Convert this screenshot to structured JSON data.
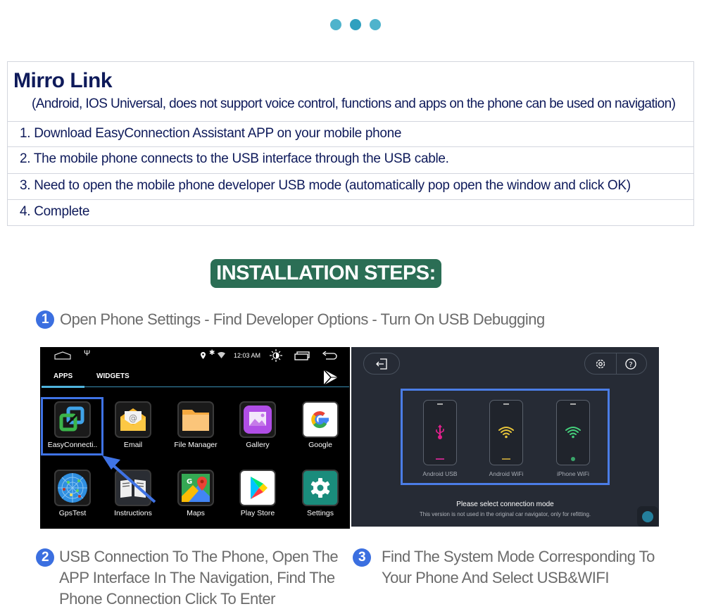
{
  "pager": {
    "count": 3,
    "active_index": 1,
    "colors": {
      "dot": "#4fb3cc",
      "active": "#2fa0bf"
    }
  },
  "mirro_link": {
    "title": "Mirro Link",
    "subtitle": "(Android, IOS Universal, does not support voice control, functions and apps on the phone can be used on navigation)",
    "steps": [
      "1. Download EasyConnection Assistant APP on your mobile phone",
      "2. The mobile phone connects to the USB interface through the USB cable.",
      "3. Need to open the mobile phone developer USB mode (automatically pop open the window and click OK)",
      "4. Complete"
    ]
  },
  "installation": {
    "badge": "INSTALLATION STEPS:",
    "badge_color": "#2b6e55",
    "step_color": "#3b6fe0",
    "steps": [
      {
        "number": "1",
        "text": "Open Phone Settings - Find Developer Options - Turn On USB Debugging"
      },
      {
        "number": "2",
        "text": "USB Connection To The Phone, Open The APP Interface In The Navigation, Find The Phone Connection Click To Enter"
      },
      {
        "number": "3",
        "text": "Find The System Mode Corresponding To Your Phone And Select USB&WIFI"
      }
    ]
  },
  "android_screen": {
    "status": {
      "time": "12:03 AM",
      "icons": [
        "home-icon",
        "usb-icon",
        "location-icon",
        "bluetooth-icon",
        "wifi-icon",
        "brightness-icon",
        "recents-icon",
        "back-icon"
      ]
    },
    "tabs": [
      {
        "label": "APPS",
        "active": true
      },
      {
        "label": "WIDGETS",
        "active": false
      }
    ],
    "apps": [
      {
        "label": "EasyConnecti..",
        "icon": "easyconnection-icon",
        "selected": true
      },
      {
        "label": "Email",
        "icon": "email-icon"
      },
      {
        "label": "File Manager",
        "icon": "folder-icon"
      },
      {
        "label": "Gallery",
        "icon": "gallery-icon"
      },
      {
        "label": "Google",
        "icon": "google-icon"
      },
      {
        "label": "GpsTest",
        "icon": "gps-radar-icon"
      },
      {
        "label": "Instructions",
        "icon": "book-icon"
      },
      {
        "label": "Maps",
        "icon": "maps-icon"
      },
      {
        "label": "Play Store",
        "icon": "play-store-icon"
      },
      {
        "label": "Settings",
        "icon": "settings-gear-icon"
      }
    ]
  },
  "connection_screen": {
    "modes": [
      {
        "label": "Android USB",
        "icon": "usb-icon",
        "color": "#e0208c"
      },
      {
        "label": "Android WiFi",
        "icon": "wifi-icon",
        "color": "#e8c53a"
      },
      {
        "label": "iPhone WiFi",
        "icon": "wifi-icon",
        "color": "#45d07c"
      }
    ],
    "title": "Please select connection mode",
    "note": "This version is not used in the original car navigator, only for refitting."
  }
}
